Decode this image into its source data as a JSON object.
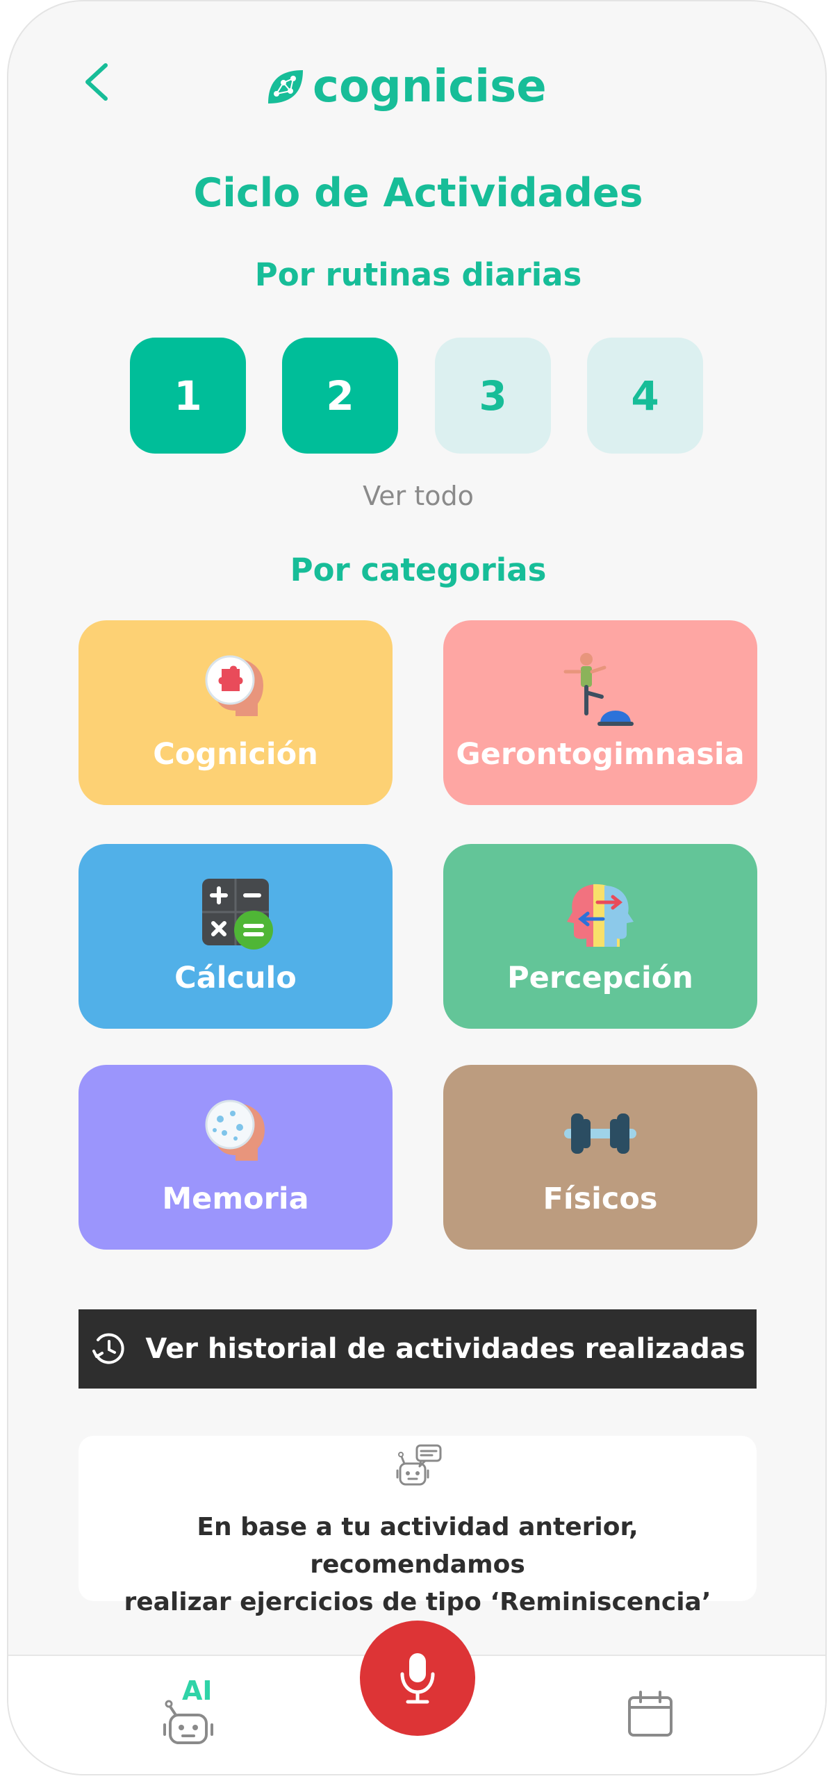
{
  "app": {
    "brand": "cognicise",
    "accent_color": "#17bd98"
  },
  "header": {
    "back_icon": "chevron-left-icon"
  },
  "page": {
    "title": "Ciclo de Actividades",
    "routines_heading": "Por rutinas diarias",
    "see_all": "Ver todo",
    "categories_heading": "Por categorias"
  },
  "routines": [
    {
      "label": "1",
      "active": true
    },
    {
      "label": "2",
      "active": true
    },
    {
      "label": "3",
      "active": false
    },
    {
      "label": "4",
      "active": false
    }
  ],
  "categories": [
    {
      "label": "Cognición",
      "icon": "head-puzzle-icon",
      "color": "#fdd174"
    },
    {
      "label": "Gerontogimnasia",
      "icon": "balance-exercise-icon",
      "color": "#fea6a3"
    },
    {
      "label": "Cálculo",
      "icon": "calculator-icon",
      "color": "#51b0e8"
    },
    {
      "label": "Percepción",
      "icon": "perception-heads-icon",
      "color": "#63c598"
    },
    {
      "label": "Memoria",
      "icon": "head-memory-icon",
      "color": "#9b95fc"
    },
    {
      "label": "Físicos",
      "icon": "dumbbell-icon",
      "color": "#bc9c7f"
    }
  ],
  "history_button": {
    "label": "Ver historial de actividades realizadas",
    "icon": "history-icon"
  },
  "recommendation": {
    "icon": "robot-chat-icon",
    "text_line1": "En base a tu actividad anterior, recomendamos",
    "text_line2": "realizar ejercicios de tipo ‘Reminiscencia’"
  },
  "bottom_nav": {
    "ai_label": "AI",
    "ai_icon": "robot-icon",
    "mic_icon": "microphone-icon",
    "mic_color": "#dd3436",
    "calendar_icon": "calendar-icon"
  }
}
